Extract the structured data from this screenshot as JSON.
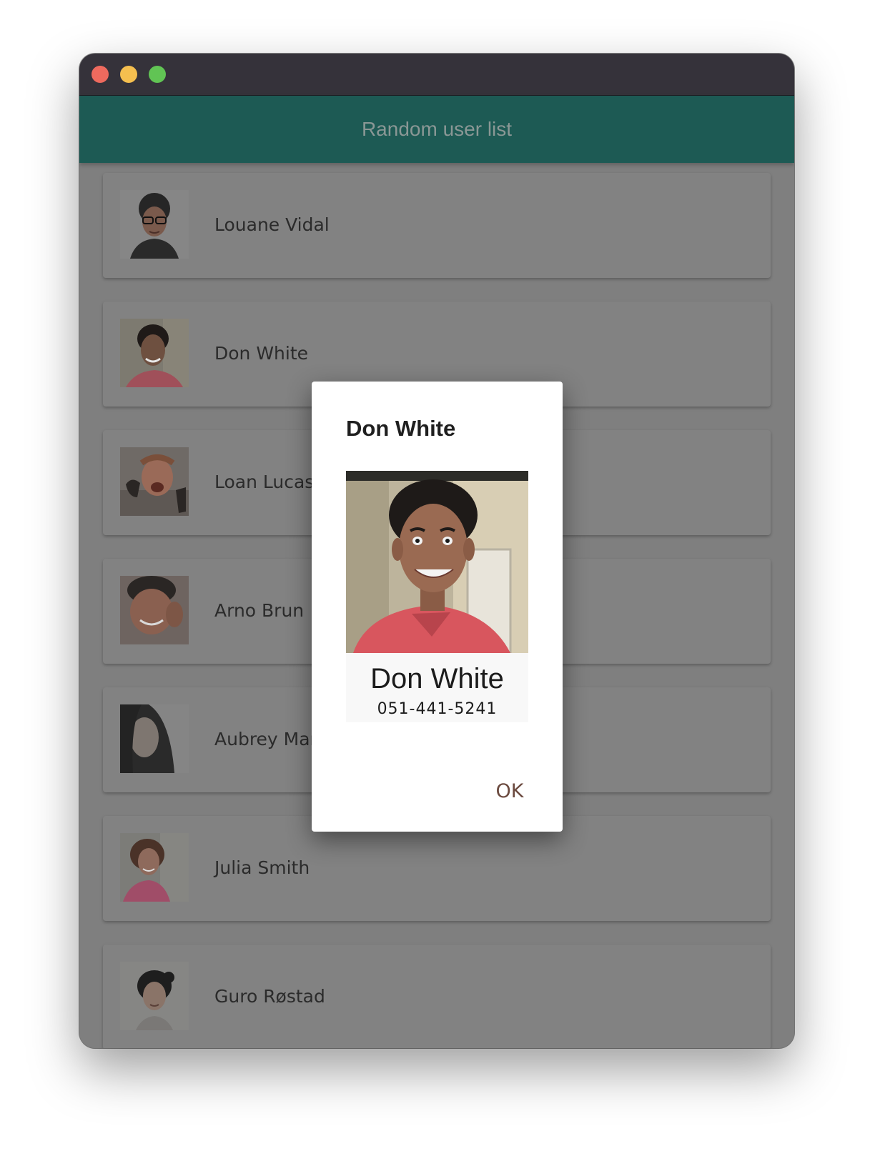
{
  "window": {
    "controls": {
      "close": {
        "icon": "close-dot-icon",
        "color": "#ee6a5e"
      },
      "minimize": {
        "icon": "minimize-dot-icon",
        "color": "#f5bf4f"
      },
      "zoom": {
        "icon": "zoom-dot-icon",
        "color": "#61c454"
      }
    }
  },
  "appbar": {
    "title": "Random user list",
    "background": "#1d5a54"
  },
  "users": [
    {
      "name": "Louane Vidal",
      "avatar": "avatar-photo-woman-glasses"
    },
    {
      "name": "Don White",
      "avatar": "avatar-photo-man-red-shirt"
    },
    {
      "name": "Loan Lucas",
      "avatar": "avatar-photo-man-shouting"
    },
    {
      "name": "Arno Brun",
      "avatar": "avatar-photo-man-smiling"
    },
    {
      "name": "Aubrey Mar",
      "avatar": "avatar-photo-woman-long-hair"
    },
    {
      "name": "Julia Smith",
      "avatar": "avatar-photo-woman-pink-top"
    },
    {
      "name": "Guro Røstad",
      "avatar": "avatar-photo-woman-short-hair"
    }
  ],
  "dialog": {
    "title": "Don White",
    "photo": "profile-photo-don-white",
    "name": "Don White",
    "phone": "051-441-5241",
    "ok_label": "OK",
    "accent": "#6b4a3f"
  }
}
